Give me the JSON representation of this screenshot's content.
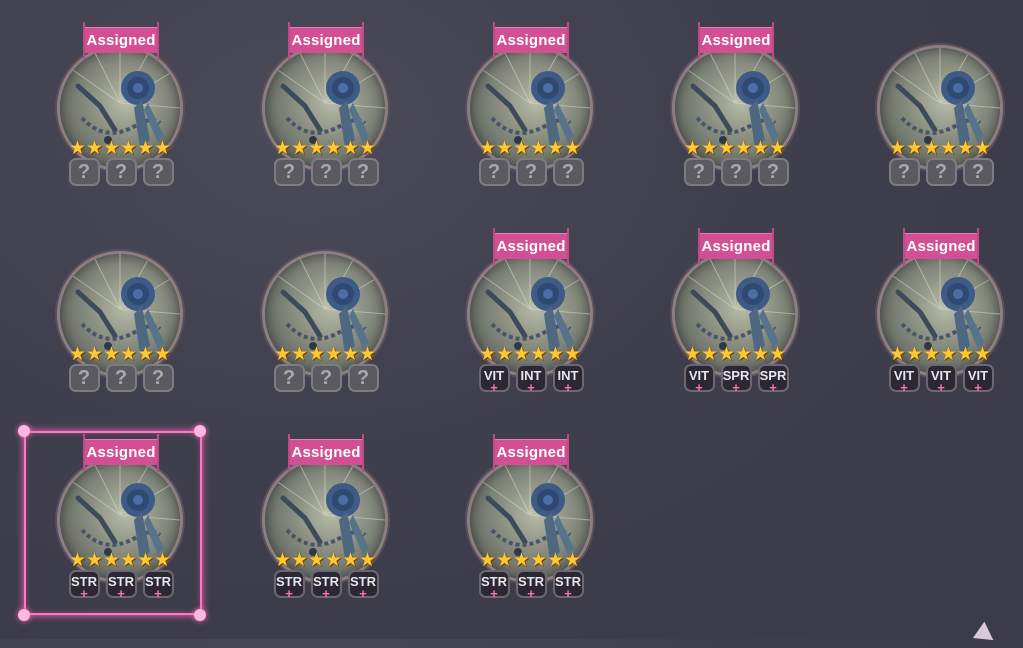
{
  "badge_label": "Assigned",
  "unknown_symbol": "?",
  "plus_symbol": "+",
  "star_symbol": "★",
  "star_count": 6,
  "items": [
    {
      "assigned": true,
      "subs": [
        "?",
        "?",
        "?"
      ]
    },
    {
      "assigned": true,
      "subs": [
        "?",
        "?",
        "?"
      ]
    },
    {
      "assigned": true,
      "subs": [
        "?",
        "?",
        "?"
      ]
    },
    {
      "assigned": true,
      "subs": [
        "?",
        "?",
        "?"
      ]
    },
    {
      "assigned": false,
      "subs": [
        "?",
        "?",
        "?"
      ]
    },
    {
      "assigned": false,
      "subs": [
        "?",
        "?",
        "?"
      ]
    },
    {
      "assigned": false,
      "subs": [
        "?",
        "?",
        "?"
      ]
    },
    {
      "assigned": true,
      "subs": [
        "VIT",
        "INT",
        "INT"
      ]
    },
    {
      "assigned": true,
      "subs": [
        "VIT",
        "SPR",
        "SPR"
      ]
    },
    {
      "assigned": true,
      "subs": [
        "VIT",
        "VIT",
        "VIT"
      ]
    },
    {
      "assigned": true,
      "subs": [
        "STR",
        "STR",
        "STR"
      ],
      "selected": true
    },
    {
      "assigned": true,
      "subs": [
        "STR",
        "STR",
        "STR"
      ]
    },
    {
      "assigned": true,
      "subs": [
        "STR",
        "STR",
        "STR"
      ]
    }
  ],
  "icon": "blue-rose-necklace-icon",
  "colors": {
    "badge": "#d14f92",
    "selection": "#ff78c4",
    "star": "#ffc834"
  }
}
